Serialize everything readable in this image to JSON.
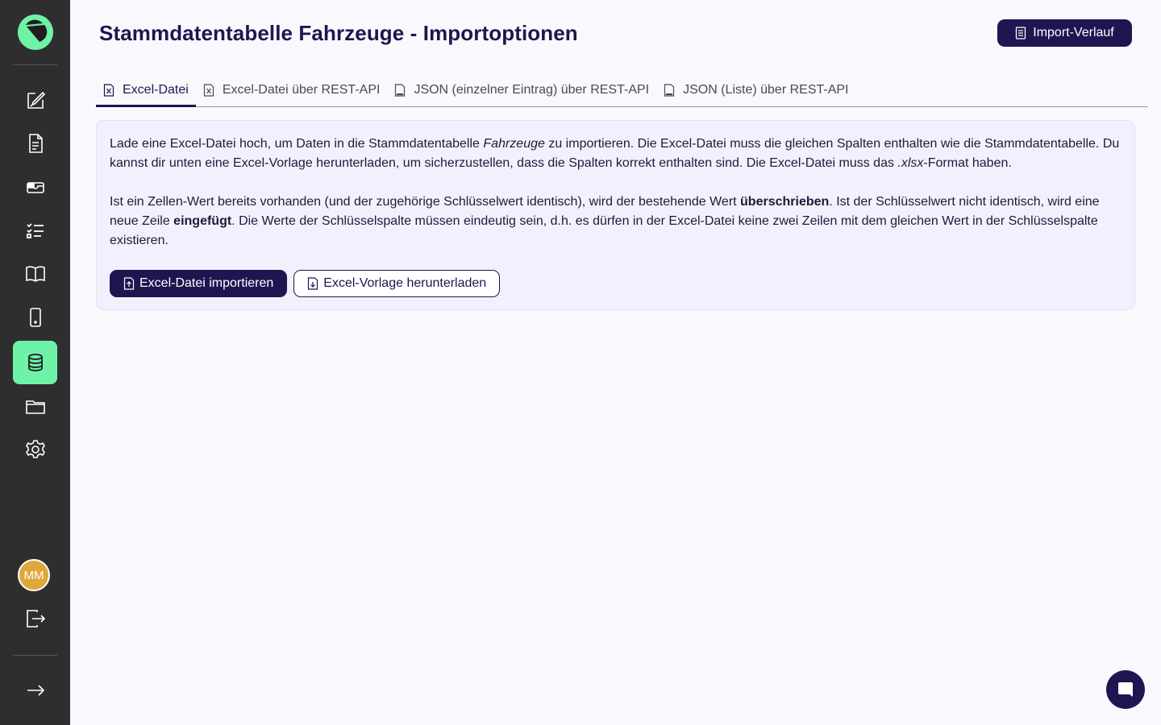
{
  "page": {
    "title": "Stammdatentabelle Fahrzeuge - Importoptionen",
    "history_button": "Import-Verlauf"
  },
  "tabs": [
    {
      "label": "Excel-Datei",
      "icon": "excel-file-icon",
      "active": true
    },
    {
      "label": "Excel-Datei über REST-API",
      "icon": "excel-file-icon",
      "active": false
    },
    {
      "label": "JSON (einzelner Eintrag) über REST-API",
      "icon": "json-file-icon",
      "active": false
    },
    {
      "label": "JSON (Liste) über REST-API",
      "icon": "json-file-icon",
      "active": false
    }
  ],
  "info": {
    "p1_part1": "Lade eine Excel-Datei hoch, um Daten in die Stammdatentabelle ",
    "p1_table": "Fahrzeuge",
    "p1_part2": " zu importieren. Die Excel-Datei muss die gleichen Spalten enthalten wie die Stammdatentabelle. Du kannst dir unten eine Excel-Vorlage herunterladen, um sicherzustellen, dass die Spalten korrekt enthalten sind. Die Excel-Datei muss das ",
    "p1_format": ".xlsx",
    "p1_part3": "-Format haben.",
    "p2_part1": "Ist ein Zellen-Wert bereits vorhanden (und der zugehörige Schlüsselwert identisch), wird der bestehende Wert ",
    "p2_bold1": "überschrieben",
    "p2_part2": ". Ist der Schlüsselwert nicht identisch, wird eine neue Zeile ",
    "p2_bold2": "eingefügt",
    "p2_part3": ". Die Werte der Schlüsselspalte müssen eindeutig sein, d.h. es dürfen in der Excel-Datei keine zwei Zeilen mit dem gleichen Wert in der Schlüsselspalte existieren."
  },
  "actions": {
    "import_label": "Excel-Datei importieren",
    "download_label": "Excel-Vorlage herunterladen"
  },
  "user": {
    "initials": "MM"
  },
  "colors": {
    "sidebar": "#2e2e2e",
    "accent": "#6ef2a8",
    "primary": "#1e1650",
    "avatar": "#e0a83a"
  }
}
